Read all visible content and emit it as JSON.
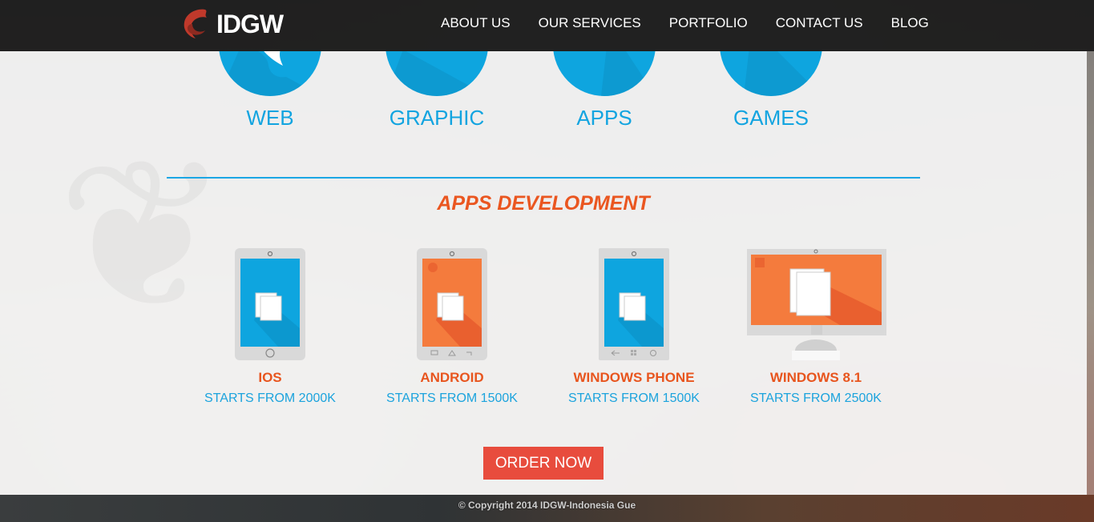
{
  "brand": {
    "name": "IDGW",
    "color": "#c0392b"
  },
  "nav": {
    "items": [
      "ABOUT US",
      "OUR SERVICES",
      "PORTFOLIO",
      "CONTACT US",
      "BLOG"
    ]
  },
  "categories": [
    {
      "label": "WEB",
      "icon": "globe-icon"
    },
    {
      "label": "GRAPHIC",
      "icon": "monitor-icon"
    },
    {
      "label": "APPS",
      "icon": "apps-icon"
    },
    {
      "label": "GAMES",
      "icon": "gamepad-icon"
    }
  ],
  "section": {
    "title": "APPS DEVELOPMENT"
  },
  "platforms": [
    {
      "name": "IOS",
      "price": "STARTS FROM 2000K",
      "icon": "iphone-icon",
      "screen_color": "#0ea5df"
    },
    {
      "name": "ANDROID",
      "price": "STARTS FROM 1500K",
      "icon": "android-tablet-icon",
      "screen_color": "#f47b3d"
    },
    {
      "name": "WINDOWS PHONE",
      "price": "STARTS FROM 1500K",
      "icon": "windows-phone-icon",
      "screen_color": "#0ea5df"
    },
    {
      "name": "WINDOWS 8.1",
      "price": "STARTS FROM 2500K",
      "icon": "windows-monitor-icon",
      "screen_color": "#f47b3d"
    }
  ],
  "order_button": {
    "label": "ORDER NOW",
    "color": "#e84c3d"
  },
  "footer": {
    "copyright": "© Copyright 2014 IDGW-Indonesia Gue"
  },
  "colors": {
    "accent_blue": "#12a4e0",
    "accent_orange": "#ea5620",
    "header_bg": "#1e1e1e"
  }
}
